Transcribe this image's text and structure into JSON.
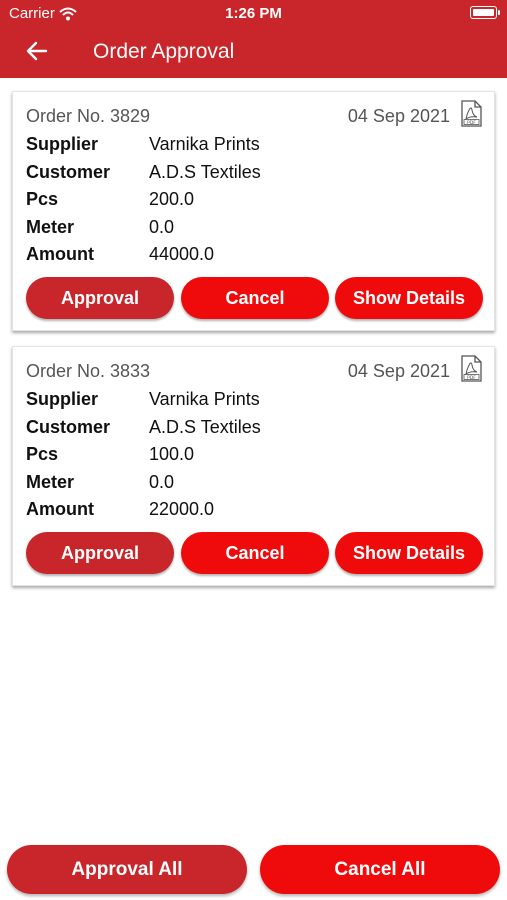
{
  "status_bar": {
    "carrier": "Carrier",
    "time": "1:26 PM"
  },
  "header": {
    "title": "Order Approval",
    "back_icon": "arrow-left-icon"
  },
  "labels": {
    "supplier": "Supplier",
    "customer": "Customer",
    "pcs": "Pcs",
    "meter": "Meter",
    "amount": "Amount",
    "approval": "Approval",
    "cancel": "Cancel",
    "show_details": "Show Details"
  },
  "orders": [
    {
      "order_no": "Order No. 3829",
      "date": "04 Sep 2021",
      "supplier": "Varnika Prints",
      "customer": "A.D.S Textiles",
      "pcs": "200.0",
      "meter": "0.0",
      "amount": "44000.0"
    },
    {
      "order_no": "Order No. 3833",
      "date": "04 Sep 2021",
      "supplier": "Varnika Prints",
      "customer": "A.D.S Textiles",
      "pcs": "100.0",
      "meter": "0.0",
      "amount": "22000.0"
    }
  ],
  "footer": {
    "approval_all": "Approval All",
    "cancel_all": "Cancel All"
  },
  "colors": {
    "primary": "#c8262b",
    "accent": "#ef0b0b"
  }
}
